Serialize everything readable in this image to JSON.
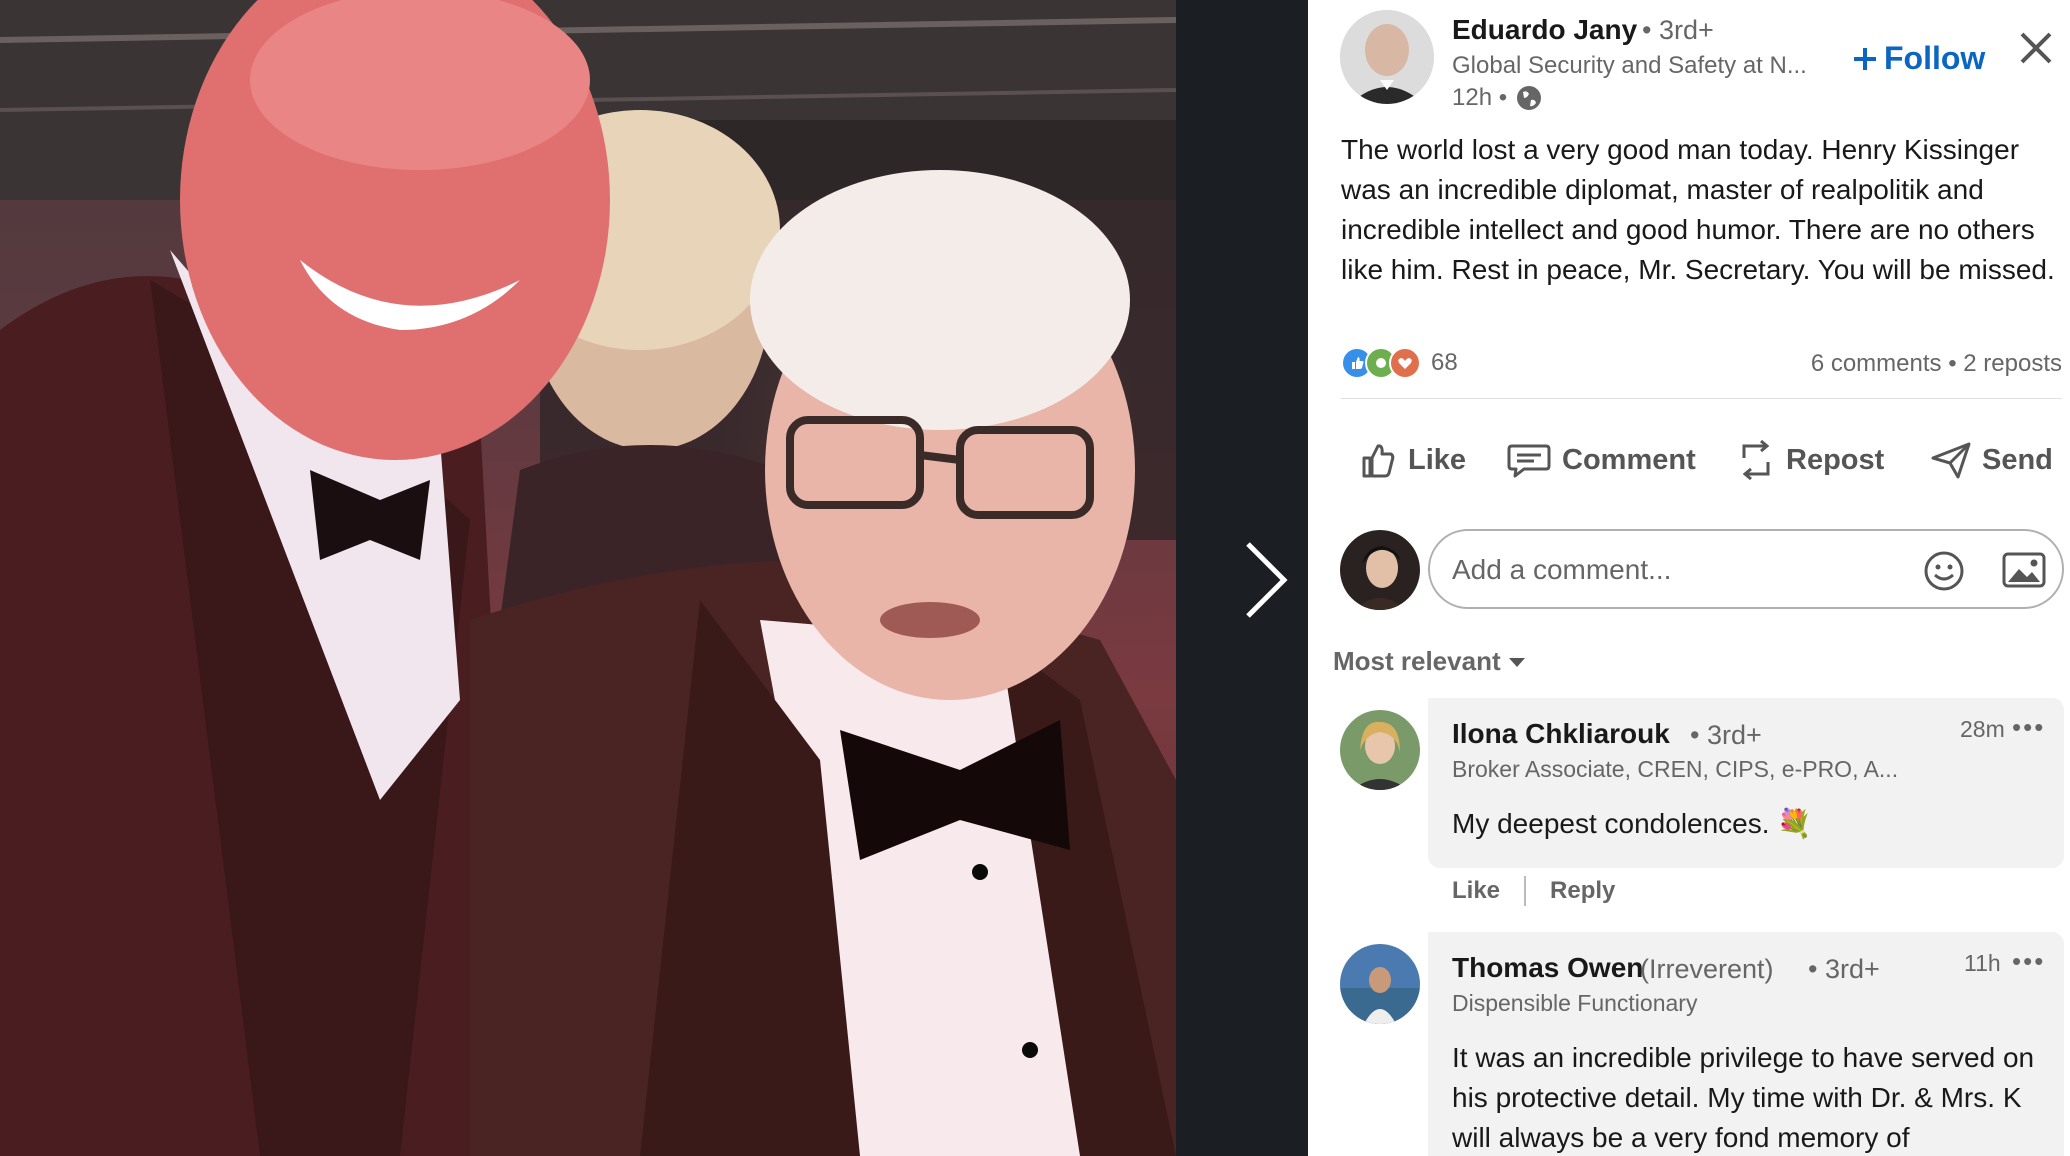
{
  "viewer": {
    "next_icon": "chevron-right-icon"
  },
  "post": {
    "author": {
      "name": "Eduardo Jany",
      "degree": "• 3rd+",
      "headline": "Global Security and Safety at N...",
      "time": "12h •",
      "visibility_icon": "globe-icon"
    },
    "follow_label": "Follow",
    "text": "The world lost a very good man today. Henry Kissinger was an incredible diplomat, master of realpolitik and incredible intellect and good humor. There are no others like him. Rest in peace, Mr. Secretary. You will be missed.",
    "reaction_count": "68",
    "comments_count": "6 comments",
    "reposts_count": "2 reposts",
    "actions": {
      "like": "Like",
      "comment": "Comment",
      "repost": "Repost",
      "send": "Send"
    }
  },
  "comment_box": {
    "placeholder": "Add a comment..."
  },
  "sort_label": "Most relevant",
  "comments": [
    {
      "name": "Ilona Chkliarouk",
      "degree": "• 3rd+",
      "headline": "Broker Associate, CREN, CIPS, e-PRO, A...",
      "time": "28m",
      "text": "My deepest condolences. 💐",
      "like": "Like",
      "reply": "Reply"
    },
    {
      "name": "Thomas Owen",
      "pronoun": "(Irreverent)",
      "degree": "• 3rd+",
      "headline": "Dispensible Functionary",
      "time": "11h",
      "text": "It was an incredible privilege to have served on his protective detail. My time with Dr. & Mrs. K will always be a very fond memory of"
    }
  ],
  "colors": {
    "accent": "#0a66c2",
    "viewer_bg": "#1b1f23"
  }
}
